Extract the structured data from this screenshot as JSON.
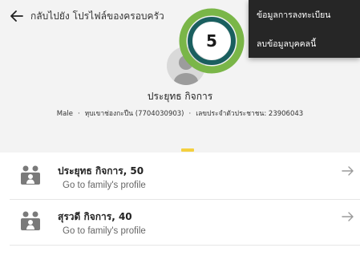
{
  "header": {
    "back_label": "กลับไปยัง โปรไฟล์ของครอบครัว",
    "person_name": "ประยุทธ กิจการ",
    "gender": "Male",
    "household_info": "หุบเขาช่องกะปืน (7704030903)",
    "id_label": "เลขประจำตัวประชาชน",
    "id_value": "23906043"
  },
  "overflow_menu": {
    "items": [
      {
        "label": "ข้อมูลการลงทะเบียน"
      },
      {
        "label": "ลบข้อมูลบุคคลนี้"
      }
    ]
  },
  "badge": {
    "label": "5",
    "colors": {
      "outer": "#7ab648",
      "inner": "#1a5f5f",
      "fill": "#ffffff"
    }
  },
  "family_members": [
    {
      "name": "ประยุทธ กิจการ, 50",
      "subtitle": "Go to family's profile"
    },
    {
      "name": "สุรวดี กิจการ, 40",
      "subtitle": "Go to family's profile"
    }
  ],
  "colors": {
    "accent": "#f4d03f",
    "menu_bg": "#262626",
    "header_bg": "#f3f3f3"
  }
}
